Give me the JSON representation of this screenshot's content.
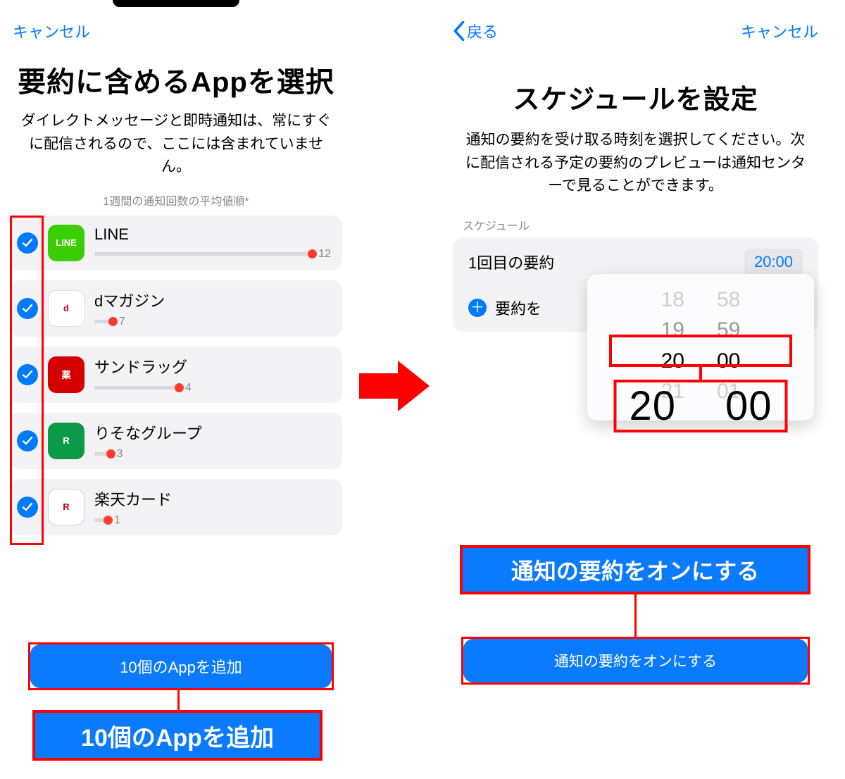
{
  "left": {
    "cancel": "キャンセル",
    "title": "要約に含めるAppを選択",
    "subtitle": "ダイレクトメッセージと即時通知は、常にすぐに配信されるので、ここには含まれていません。",
    "sort_label": "1週間の通知回数の平均値順*",
    "apps": [
      {
        "name": "LINE",
        "count": "12",
        "bar_pct": 100,
        "icon_bg": "#3ACE01",
        "icon_text": "LINE",
        "icon_color": "#fff"
      },
      {
        "name": "dマガジン",
        "count": "7",
        "bar_pct": 8,
        "icon_bg": "#ffffff",
        "icon_text": "d",
        "icon_color": "#cc0033",
        "icon_border": "#e0e0e0"
      },
      {
        "name": "サンドラッグ",
        "count": "4",
        "bar_pct": 36,
        "icon_bg": "#d50000",
        "icon_text": "薬",
        "icon_color": "#fff"
      },
      {
        "name": "りそなグループ",
        "count": "3",
        "bar_pct": 7,
        "icon_bg": "#0b9a47",
        "icon_text": "R",
        "icon_color": "#fff"
      },
      {
        "name": "楽天カード",
        "count": "1",
        "bar_pct": 6,
        "icon_bg": "#ffffff",
        "icon_text": "R",
        "icon_color": "#bf0000",
        "icon_border": "#d0d0d0"
      }
    ],
    "primary_button": "10個のAppを追加",
    "big_callout": "10個のAppを追加"
  },
  "right": {
    "back": "戻る",
    "cancel": "キャンセル",
    "title": "スケジュールを設定",
    "subtitle": "通知の要約を受け取る時刻を選択してください。次に配信される予定の要約のプレビューは通知センターで見ることができます。",
    "section_label": "スケジュール",
    "row_label": "1回目の要約",
    "row_time": "20:00",
    "add_label": "要約を",
    "picker": {
      "hours": [
        "18",
        "19",
        "20",
        "21"
      ],
      "minutes": [
        "58",
        "59",
        "00",
        "01"
      ],
      "selected_hour": "20",
      "selected_minute": "00"
    },
    "big_time_hour": "20",
    "big_time_minute": "00",
    "big_callout": "通知の要約をオンにする",
    "primary_button": "通知の要約をオンにする"
  }
}
